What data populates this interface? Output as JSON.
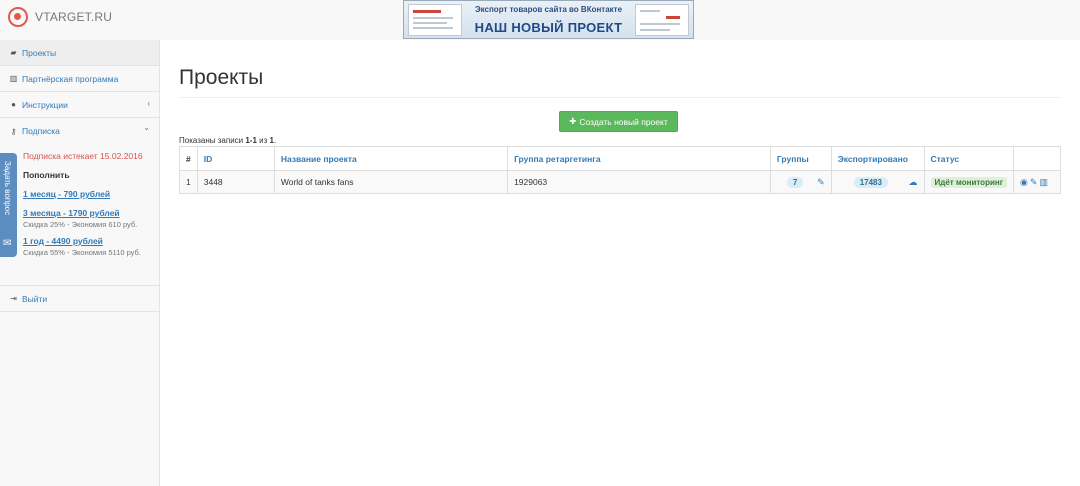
{
  "header": {
    "logo_text": "VTARGET.RU",
    "banner_subtitle": "Экспорт товаров сайта во ВКонтакте",
    "banner_title": "НАШ НОВЫЙ ПРОЕКТ"
  },
  "sidebar": {
    "items": [
      {
        "label": "Проекты",
        "icon": "briefcase-icon"
      },
      {
        "label": "Партнёрская программа",
        "icon": "bar-chart-icon"
      },
      {
        "label": "Инструкции",
        "icon": "info-icon",
        "arrow": "‹"
      },
      {
        "label": "Подписка",
        "icon": "key-icon",
        "arrow": "⌄"
      }
    ],
    "subscription": {
      "expires": "Подписка истекает 15.02.2016",
      "topup": "Пополнить",
      "plans": [
        {
          "label": "1 месяц - 790 рублей",
          "note": ""
        },
        {
          "label": "3 месяца - 1790 рублей",
          "note": "Скидка 25% - Экономия 610 руб."
        },
        {
          "label": "1 год - 4490 рублей",
          "note": "Скидка 55% - Экономия 5110 руб."
        }
      ]
    },
    "logout": {
      "label": "Выйти",
      "icon": "sign-out-icon"
    }
  },
  "feedback": {
    "label": "Задать вопрос",
    "icon": "envelope-icon"
  },
  "main": {
    "title": "Проекты",
    "create_button": "Создать новый проект",
    "shown_prefix": "Показаны записи ",
    "shown_range": "1-1",
    "shown_of": " из ",
    "shown_total": "1",
    "shown_suffix": ".",
    "columns": [
      "#",
      "ID",
      "Название проекта",
      "Группа ретаргетинга",
      "Группы",
      "Экспортировано",
      "Статус",
      ""
    ],
    "rows": [
      {
        "num": "1",
        "id": "3448",
        "name": "World of tanks fans",
        "group": "1929063",
        "groups_count": "7",
        "exported": "17483",
        "status": "Идёт мониторинг"
      }
    ]
  },
  "colors": {
    "link": "#337ab7",
    "accent_green": "#5cb85c",
    "danger": "#d9534f",
    "logo": "#e05a4b"
  }
}
